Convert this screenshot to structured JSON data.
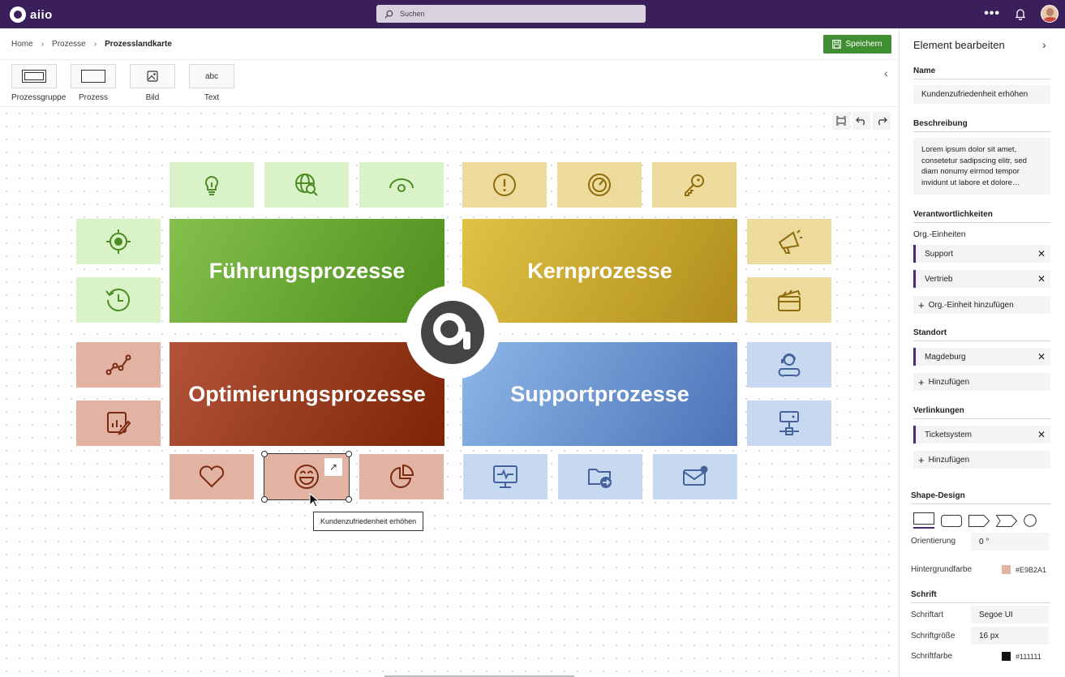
{
  "topbar": {
    "brand": "aiio",
    "search_placeholder": "Suchen",
    "more": "•••"
  },
  "breadcrumb": {
    "items": [
      "Home",
      "Prozesse",
      "Prozesslandkarte"
    ]
  },
  "toolbar": {
    "save_label": "Speichern"
  },
  "palette": {
    "items": [
      {
        "label": "Prozessgruppe",
        "icon": "process-group-icon"
      },
      {
        "label": "Prozess",
        "icon": "process-icon"
      },
      {
        "label": "Bild",
        "icon": "image-icon"
      },
      {
        "label": "Text",
        "icon": "text-icon",
        "glyph": "abc"
      }
    ]
  },
  "map": {
    "groups": [
      {
        "label": "Führungsprozesse",
        "color": "#6aa735"
      },
      {
        "label": "Kernprozesse",
        "color": "#c9a82c"
      },
      {
        "label": "Optimierungsprozesse",
        "color": "#9a3a1c"
      },
      {
        "label": "Supportprozesse",
        "color": "#6b95d2"
      }
    ],
    "tile_colors": {
      "green": "#d9f2c8",
      "yellow": "#ecdb9c",
      "red": "#e2b2a2",
      "blue": "#c7d9f0"
    },
    "selected_tooltip": "Kundenzufriedenheit erhöhen"
  },
  "panel": {
    "title": "Element bearbeiten",
    "name_label": "Name",
    "name_value": "Kundenzufriedenheit erhöhen",
    "description_label": "Beschreibung",
    "description_value": "Lorem ipsum dolor sit amet, consetetur sadipscing elitr, sed diam nonumy eirmod tempor invidunt ut labore et dolore…",
    "responsibilities_label": "Verantwortlichkeiten",
    "org_units_label": "Org.-Einheiten",
    "org_units": [
      "Support",
      "Vertrieb"
    ],
    "add_org_unit": "Org.-Einheit hinzufügen",
    "location_label": "Standort",
    "location": "Magdeburg",
    "add_label": "Hinzufügen",
    "links_label": "Verlinkungen",
    "link": "Ticketsystem",
    "add_link_label": "Hinzufügen",
    "shape_design_label": "Shape-Design",
    "orientation_label": "Orientierung",
    "orientation_value": "0 °",
    "bg_color_label": "Hintergrundfarbe",
    "bg_color_value": "#E9B2A1",
    "font_section_label": "Schrift",
    "font_family_label": "Schriftart",
    "font_family_value": "Segoe UI",
    "font_size_label": "Schriftgröße",
    "font_size_value": "16 px",
    "font_color_label": "Schriftfarbe",
    "font_color_value": "#111111"
  }
}
